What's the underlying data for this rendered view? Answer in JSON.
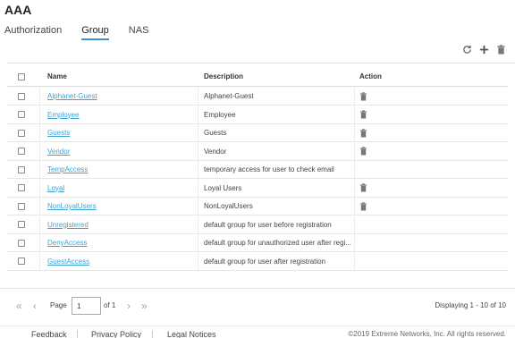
{
  "page": {
    "title": "AAA"
  },
  "tabs": [
    {
      "label": "Authorization"
    },
    {
      "label": "Group",
      "active": true
    },
    {
      "label": "NAS"
    }
  ],
  "toolbar": {
    "icons": [
      "refresh-icon",
      "add-icon",
      "delete-icon"
    ]
  },
  "table": {
    "columns": {
      "name": "Name",
      "description": "Description",
      "action": "Action"
    },
    "rows": [
      {
        "name": "Alphanet-Guest",
        "description": "Alphanet-Guest",
        "deletable": true
      },
      {
        "name": "Employee",
        "description": "Employee",
        "deletable": true
      },
      {
        "name": "Guests",
        "description": "Guests",
        "deletable": true
      },
      {
        "name": "Vendor",
        "description": "Vendor",
        "deletable": true
      },
      {
        "name": "TempAccess",
        "description": "temporary access for user to check email",
        "deletable": false
      },
      {
        "name": "Loyal",
        "description": "Loyal Users",
        "deletable": true
      },
      {
        "name": "NonLoyalUsers",
        "description": "NonLoyalUsers",
        "deletable": true
      },
      {
        "name": "Unregistered",
        "description": "default group for user before registration",
        "deletable": false
      },
      {
        "name": "DenyAccess",
        "description": "default group for unauthorized user after regi...",
        "deletable": false
      },
      {
        "name": "GuestAccess",
        "description": "default group for user after registration",
        "deletable": false
      }
    ]
  },
  "pager": {
    "page_label": "Page",
    "current_page": "1",
    "of_label": "of 1",
    "display_info": "Displaying 1 - 10 of 10"
  },
  "footer": {
    "feedback": "Feedback",
    "privacy": "Privacy Policy",
    "legal": "Legal Notices",
    "copyright": "©2019 Extreme Networks, Inc. All rights reserved."
  },
  "colors": {
    "link": "#3aa3d6",
    "tab_underline": "#3a8fd6"
  }
}
